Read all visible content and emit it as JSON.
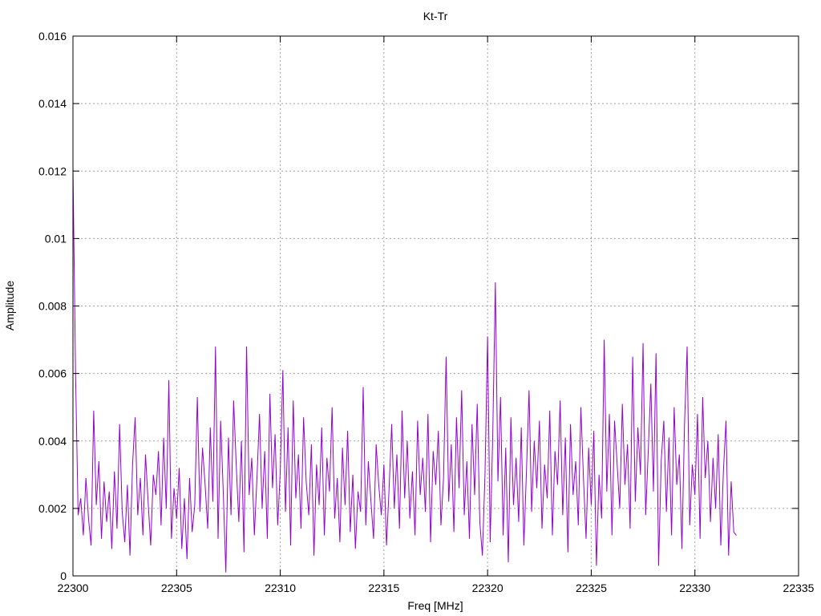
{
  "chart_data": {
    "type": "line",
    "title": "Kt-Tr",
    "xlabel": "Freq [MHz]",
    "ylabel": "Amplitude",
    "xlim": [
      22300,
      22335
    ],
    "ylim": [
      0,
      0.016
    ],
    "grid": true,
    "legend": "none",
    "x_ticks": [
      "22300",
      "22305",
      "22310",
      "22315",
      "22320",
      "22325",
      "22330",
      "22335"
    ],
    "x_tick_values": [
      22300,
      22305,
      22310,
      22315,
      22320,
      22325,
      22330,
      22335
    ],
    "y_ticks": [
      "0",
      "0.002",
      "0.004",
      "0.006",
      "0.008",
      "0.01",
      "0.012",
      "0.014",
      "0.016"
    ],
    "y_tick_values": [
      0,
      0.002,
      0.004,
      0.006,
      0.008,
      0.01,
      0.012,
      0.014,
      0.016
    ],
    "series": [
      {
        "name": "Kt-Tr",
        "color": "#9400d3",
        "x_start": 22300,
        "x_step": 0.125,
        "values": [
          0.0121,
          0.006,
          0.0018,
          0.0023,
          0.0012,
          0.0029,
          0.0017,
          0.0009,
          0.0049,
          0.0021,
          0.0034,
          0.0011,
          0.0028,
          0.0016,
          0.0025,
          0.0008,
          0.0031,
          0.0014,
          0.0045,
          0.0019,
          0.001,
          0.0027,
          0.0006,
          0.0033,
          0.0047,
          0.0018,
          0.0029,
          0.0012,
          0.0036,
          0.0022,
          0.0009,
          0.003,
          0.0024,
          0.0037,
          0.0015,
          0.0041,
          0.002,
          0.0058,
          0.0011,
          0.0026,
          0.0017,
          0.0032,
          0.0008,
          0.0023,
          0.0005,
          0.0029,
          0.0013,
          0.0021,
          0.0053,
          0.0019,
          0.0038,
          0.0027,
          0.0014,
          0.0044,
          0.0022,
          0.0068,
          0.0011,
          0.0046,
          0.0025,
          0.0001,
          0.0041,
          0.0018,
          0.0052,
          0.0033,
          0.0016,
          0.004,
          0.0007,
          0.0068,
          0.0024,
          0.0035,
          0.0012,
          0.0029,
          0.0048,
          0.002,
          0.0037,
          0.0011,
          0.0054,
          0.0026,
          0.0042,
          0.0015,
          0.0031,
          0.0061,
          0.0019,
          0.0044,
          0.0009,
          0.0052,
          0.0023,
          0.0036,
          0.0014,
          0.0047,
          0.0028,
          0.0018,
          0.0039,
          0.0006,
          0.0033,
          0.0021,
          0.0044,
          0.0012,
          0.0035,
          0.0025,
          0.005,
          0.0017,
          0.0029,
          0.001,
          0.0038,
          0.0021,
          0.0043,
          0.0013,
          0.003,
          0.0008,
          0.0025,
          0.0019,
          0.0056,
          0.0015,
          0.0034,
          0.0022,
          0.0011,
          0.0039,
          0.0027,
          0.0018,
          0.0033,
          0.0009,
          0.0026,
          0.0045,
          0.002,
          0.0036,
          0.0014,
          0.0049,
          0.0023,
          0.004,
          0.0017,
          0.0031,
          0.0012,
          0.0046,
          0.0024,
          0.0035,
          0.0019,
          0.0048,
          0.001,
          0.0037,
          0.0027,
          0.0043,
          0.0015,
          0.0029,
          0.0065,
          0.0022,
          0.0039,
          0.0013,
          0.0047,
          0.0026,
          0.0055,
          0.0018,
          0.0034,
          0.0011,
          0.0045,
          0.0024,
          0.0051,
          0.0016,
          0.0006,
          0.003,
          0.0071,
          0.001,
          0.0042,
          0.0087,
          0.0028,
          0.0053,
          0.0012,
          0.0038,
          0.0004,
          0.0047,
          0.0021,
          0.0035,
          0.0016,
          0.0044,
          0.0009,
          0.0031,
          0.0055,
          0.0019,
          0.004,
          0.0026,
          0.0046,
          0.0014,
          0.0033,
          0.0023,
          0.0049,
          0.0012,
          0.0037,
          0.0027,
          0.0052,
          0.0018,
          0.0041,
          0.0007,
          0.0045,
          0.0024,
          0.0034,
          0.0015,
          0.005,
          0.0029,
          0.0011,
          0.0038,
          0.0021,
          0.0043,
          0.0003,
          0.003,
          0.0017,
          0.007,
          0.0025,
          0.0048,
          0.0012,
          0.0046,
          0.0033,
          0.002,
          0.0051,
          0.0027,
          0.0039,
          0.0014,
          0.0065,
          0.0022,
          0.0044,
          0.003,
          0.0069,
          0.0018,
          0.0037,
          0.0057,
          0.0025,
          0.0066,
          0.0003,
          0.0034,
          0.0046,
          0.0019,
          0.0041,
          0.0012,
          0.005,
          0.0027,
          0.0036,
          0.0008,
          0.0045,
          0.0068,
          0.0015,
          0.0033,
          0.0024,
          0.0048,
          0.0011,
          0.0053,
          0.0029,
          0.004,
          0.0016,
          0.0035,
          0.002,
          0.0042,
          0.0009,
          0.0031,
          0.0046,
          0.0006,
          0.0028,
          0.0013,
          0.0012
        ]
      }
    ]
  }
}
